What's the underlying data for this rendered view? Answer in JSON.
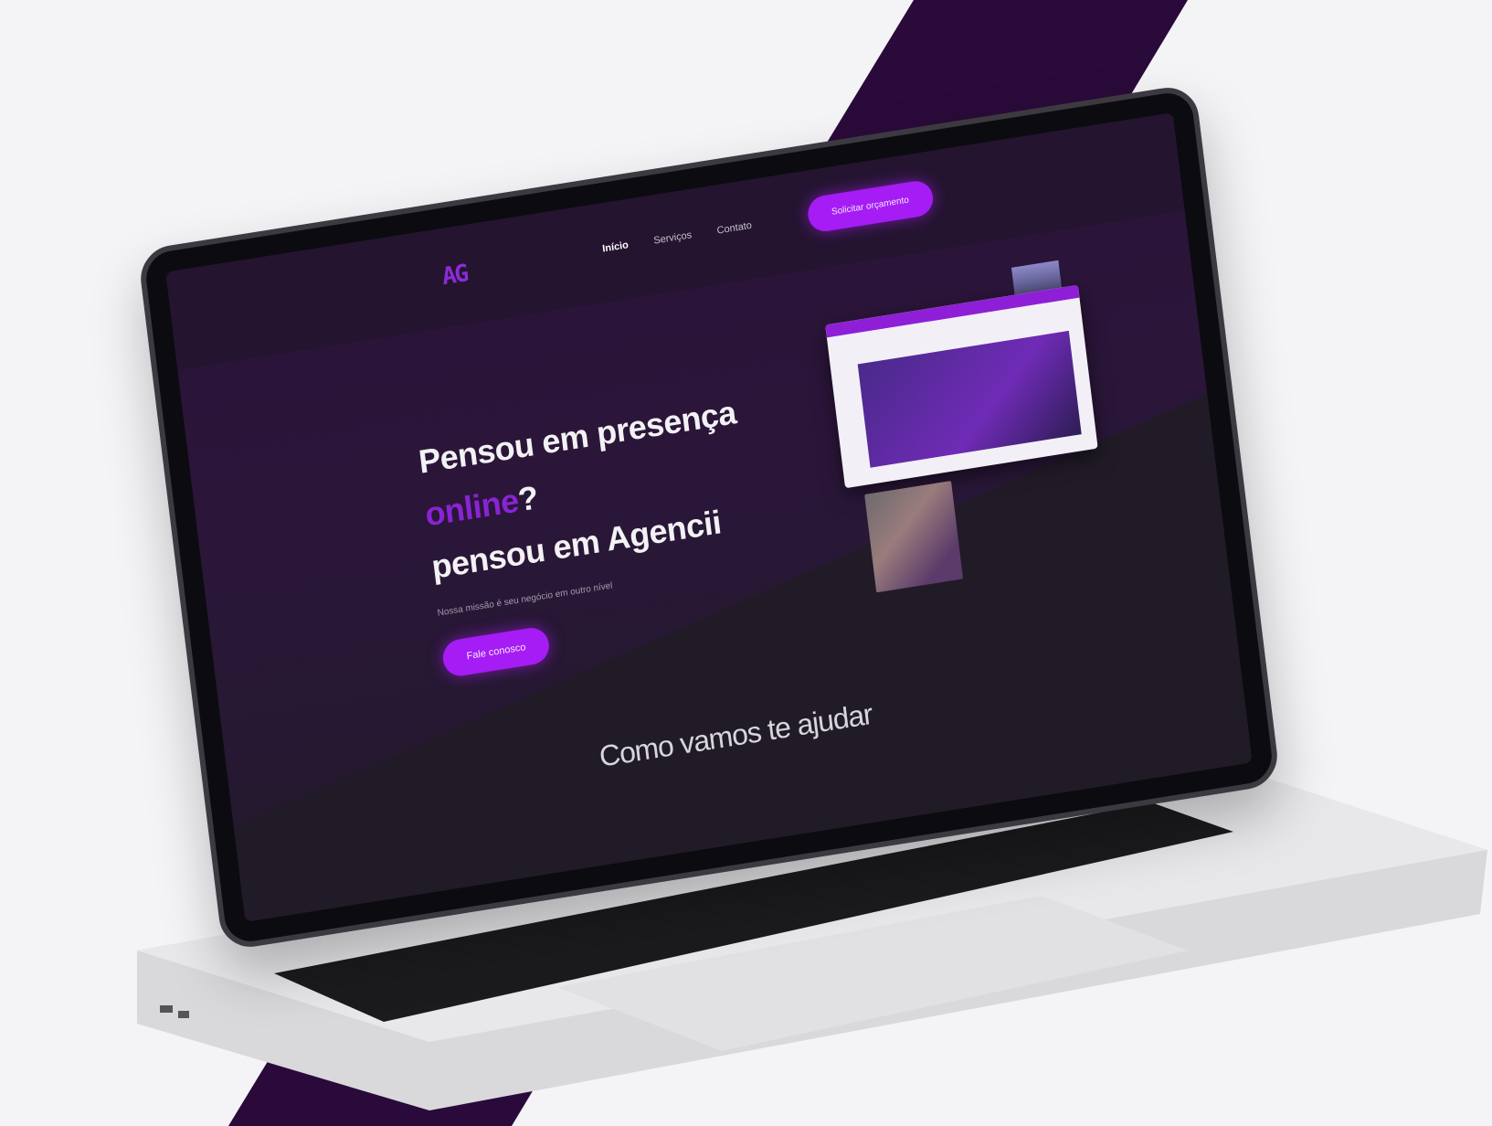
{
  "colors": {
    "background": "#f4f4f7",
    "stripe": "#2a0a3a",
    "accent": "#a51cf4",
    "screen_bg": "#211b27"
  },
  "site": {
    "logo": "AG",
    "nav": [
      "Início",
      "Serviços",
      "Contato"
    ],
    "cta_top": "Solicitar orçamento",
    "hero": {
      "line1": "Pensou em presença",
      "accent_word": "online",
      "accent_suffix": "?",
      "line3": "pensou em Agencii",
      "subtitle": "Nossa missão é seu negócio em outro nível",
      "button": "Fale conosco"
    },
    "section_title": "Como vamos te ajudar"
  }
}
